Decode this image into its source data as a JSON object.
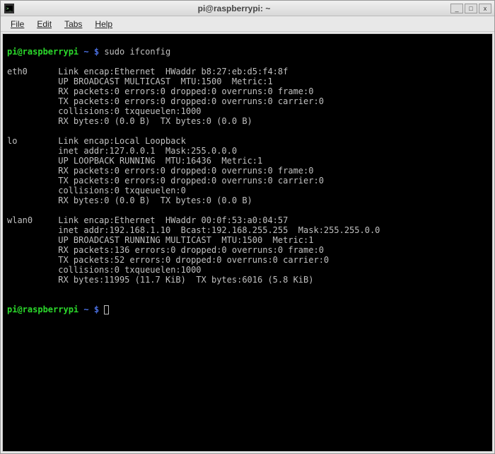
{
  "window": {
    "title": "pi@raspberrypi: ~"
  },
  "menubar": {
    "items": [
      "File",
      "Edit",
      "Tabs",
      "Help"
    ]
  },
  "prompt": {
    "user_host": "pi@raspberrypi",
    "path": "~",
    "symbol": "$"
  },
  "command": "sudo ifconfig",
  "interfaces": [
    {
      "name": "eth0",
      "lines": [
        "Link encap:Ethernet  HWaddr b8:27:eb:d5:f4:8f",
        "UP BROADCAST MULTICAST  MTU:1500  Metric:1",
        "RX packets:0 errors:0 dropped:0 overruns:0 frame:0",
        "TX packets:0 errors:0 dropped:0 overruns:0 carrier:0",
        "collisions:0 txqueuelen:1000",
        "RX bytes:0 (0.0 B)  TX bytes:0 (0.0 B)"
      ]
    },
    {
      "name": "lo",
      "lines": [
        "Link encap:Local Loopback",
        "inet addr:127.0.0.1  Mask:255.0.0.0",
        "UP LOOPBACK RUNNING  MTU:16436  Metric:1",
        "RX packets:0 errors:0 dropped:0 overruns:0 frame:0",
        "TX packets:0 errors:0 dropped:0 overruns:0 carrier:0",
        "collisions:0 txqueuelen:0",
        "RX bytes:0 (0.0 B)  TX bytes:0 (0.0 B)"
      ]
    },
    {
      "name": "wlan0",
      "lines": [
        "Link encap:Ethernet  HWaddr 00:0f:53:a0:04:57",
        "inet addr:192.168.1.10  Bcast:192.168.255.255  Mask:255.255.0.0",
        "UP BROADCAST RUNNING MULTICAST  MTU:1500  Metric:1",
        "RX packets:136 errors:0 dropped:0 overruns:0 frame:0",
        "TX packets:52 errors:0 dropped:0 overruns:0 carrier:0",
        "collisions:0 txqueuelen:1000",
        "RX bytes:11995 (11.7 KiB)  TX bytes:6016 (5.8 KiB)"
      ]
    }
  ]
}
